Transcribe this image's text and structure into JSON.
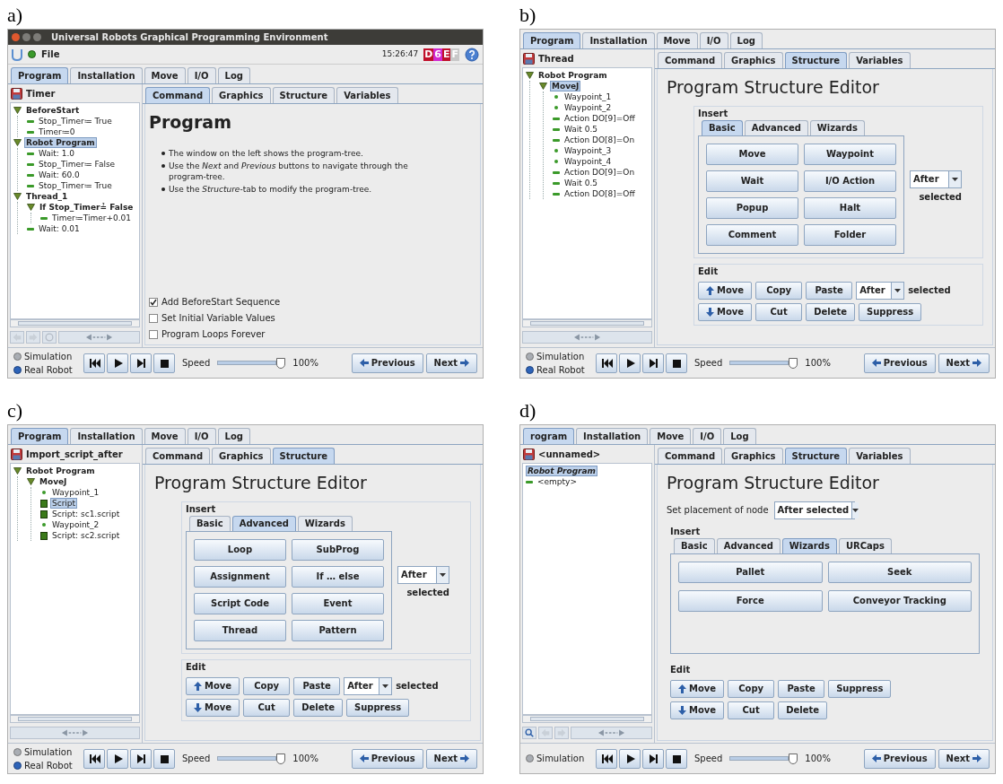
{
  "panels": [
    {
      "label": "a)",
      "window": {
        "title": "Universal Robots Graphical Programming Environment"
      },
      "menu": {
        "file": "File",
        "time": "15:26:47",
        "badge": [
          {
            "text": "D",
            "color": "#c0102a"
          },
          {
            "text": "6",
            "color": "#d02ad0"
          },
          {
            "text": "E",
            "color": "#c0102a"
          },
          {
            "text": "F",
            "color": "#c8c8c8"
          }
        ]
      },
      "tabs": [
        {
          "label": "Program",
          "selected": true
        },
        {
          "label": "Installation",
          "selected": false
        },
        {
          "label": "Move",
          "selected": false
        },
        {
          "label": "I/O",
          "selected": false
        },
        {
          "label": "Log",
          "selected": false
        }
      ],
      "program_name": "Timer",
      "subtabs": [
        {
          "label": "Command",
          "selected": true
        },
        {
          "label": "Graphics",
          "selected": false
        },
        {
          "label": "Structure",
          "selected": false
        },
        {
          "label": "Variables",
          "selected": false
        }
      ],
      "tree": [
        {
          "label": "BeforeStart",
          "kind": "group",
          "expanded": true,
          "selected": false,
          "children": [
            {
              "label": "Stop_Timer≔ True",
              "kind": "step",
              "selected": false
            },
            {
              "label": "Timer≔0",
              "kind": "step",
              "selected": false
            }
          ]
        },
        {
          "label": "Robot Program",
          "kind": "group",
          "expanded": true,
          "selected": true,
          "children": [
            {
              "label": "Wait: 1.0",
              "kind": "step",
              "selected": false
            },
            {
              "label": "Stop_Timer≔ False",
              "kind": "step",
              "selected": false
            },
            {
              "label": "Wait: 60.0",
              "kind": "step",
              "selected": false
            },
            {
              "label": "Stop_Timer≔ True",
              "kind": "step",
              "selected": false
            }
          ]
        },
        {
          "label": "Thread_1",
          "kind": "group",
          "expanded": true,
          "selected": false,
          "children": [
            {
              "label": "If Stop_Timer≟ False",
              "kind": "group",
              "expanded": true,
              "selected": false,
              "children": [
                {
                  "label": "Timer≔Timer+0.01",
                  "kind": "step",
                  "selected": false
                }
              ]
            },
            {
              "label": "Wait: 0.01",
              "kind": "step",
              "selected": false
            }
          ]
        }
      ],
      "tree_tools": [
        {
          "kind": "undo"
        },
        {
          "kind": "redo"
        },
        {
          "kind": "circle"
        },
        {
          "kind": "arrows"
        }
      ],
      "content": {
        "kind": "info",
        "heading": "Program",
        "bullets": [
          "The window on the left shows the program-tree.",
          "Use the *Next* and *Previous* buttons to navigate through the program-tree.",
          "Use the *Structure*-tab to modify the program-tree."
        ],
        "checkboxes": [
          {
            "label": "Add BeforeStart Sequence",
            "checked": true
          },
          {
            "label": "Set Initial Variable Values",
            "checked": false
          },
          {
            "label": "Program Loops Forever",
            "checked": false
          }
        ]
      },
      "footer": {
        "modes": [
          {
            "label": "Simulation",
            "selected": false
          },
          {
            "label": "Real Robot",
            "selected": true
          }
        ],
        "speed_label": "Speed",
        "speed": {
          "level": 1
        },
        "speed_reading": "100%",
        "previous": "Previous",
        "next": "Next"
      }
    },
    {
      "label": "b)",
      "tabs": [
        {
          "label": "Program",
          "selected": true
        },
        {
          "label": "Installation",
          "selected": false
        },
        {
          "label": "Move",
          "selected": false
        },
        {
          "label": "I/O",
          "selected": false
        },
        {
          "label": "Log",
          "selected": false
        }
      ],
      "program_name": "Thread",
      "subtabs": [
        {
          "label": "Command",
          "selected": false
        },
        {
          "label": "Graphics",
          "selected": false
        },
        {
          "label": "Structure",
          "selected": true
        },
        {
          "label": "Variables",
          "selected": false
        }
      ],
      "tree": [
        {
          "label": "Robot Program",
          "kind": "group",
          "expanded": true,
          "selected": false,
          "children": [
            {
              "label": "MoveJ",
              "kind": "group",
              "expanded": true,
              "selected": true,
              "children": [
                {
                  "label": "Waypoint_1",
                  "kind": "waypoint",
                  "selected": false
                },
                {
                  "label": "Waypoint_2",
                  "kind": "waypoint",
                  "selected": false
                },
                {
                  "label": "Action DO[9]=Off",
                  "kind": "step",
                  "selected": false
                },
                {
                  "label": "Wait 0.5",
                  "kind": "step",
                  "selected": false
                },
                {
                  "label": "Action DO[8]=On",
                  "kind": "step",
                  "selected": false
                },
                {
                  "label": "Waypoint_3",
                  "kind": "waypoint",
                  "selected": false
                },
                {
                  "label": "Waypoint_4",
                  "kind": "waypoint",
                  "selected": false
                },
                {
                  "label": "Action DO[9]=On",
                  "kind": "step",
                  "selected": false
                },
                {
                  "label": "Wait 0.5",
                  "kind": "step",
                  "selected": false
                },
                {
                  "label": "Action DO[8]=Off",
                  "kind": "step",
                  "selected": false
                }
              ]
            }
          ]
        }
      ],
      "tree_tools": [
        {
          "kind": "arrows"
        }
      ],
      "content": {
        "kind": "structure",
        "heading": "Program Structure Editor",
        "insert": {
          "legend": "Insert",
          "tabs": [
            {
              "label": "Basic",
              "selected": true
            },
            {
              "label": "Advanced",
              "selected": false
            },
            {
              "label": "Wizards",
              "selected": false
            }
          ],
          "buttons": [
            "Move",
            "Waypoint",
            "Wait",
            "I/O Action",
            "Popup",
            "Halt",
            "Comment",
            "Folder"
          ],
          "placement": "After",
          "placement_note": "selected"
        },
        "edit": {
          "legend": "Edit",
          "rows": [
            [
              {
                "kind": "up_button",
                "label": "Move"
              },
              {
                "kind": "button",
                "label": "Copy"
              },
              {
                "kind": "button",
                "label": "Paste"
              },
              {
                "kind": "dropdown",
                "label": "After"
              },
              {
                "kind": "text",
                "label": "selected"
              }
            ],
            [
              {
                "kind": "down_button",
                "label": "Move"
              },
              {
                "kind": "button",
                "label": "Cut"
              },
              {
                "kind": "button",
                "label": "Delete"
              },
              {
                "kind": "button",
                "label": "Suppress"
              }
            ]
          ]
        }
      },
      "footer": {
        "modes": [
          {
            "label": "Simulation",
            "selected": false
          },
          {
            "label": "Real Robot",
            "selected": true
          }
        ],
        "speed_label": "Speed",
        "speed": {
          "level": 1
        },
        "speed_reading": "100%",
        "previous": "Previous",
        "next": "Next"
      }
    },
    {
      "label": "c)",
      "tabs": [
        {
          "label": "Program",
          "selected": true
        },
        {
          "label": "Installation",
          "selected": false
        },
        {
          "label": "Move",
          "selected": false
        },
        {
          "label": "I/O",
          "selected": false
        },
        {
          "label": "Log",
          "selected": false
        }
      ],
      "program_name": "Import_script_after",
      "subtabs": [
        {
          "label": "Command",
          "selected": false
        },
        {
          "label": "Graphics",
          "selected": false
        },
        {
          "label": "Structure",
          "selected": true
        }
      ],
      "tree": [
        {
          "label": "Robot Program",
          "kind": "group",
          "expanded": true,
          "selected": false,
          "children": [
            {
              "label": "MoveJ",
              "kind": "group",
              "expanded": true,
              "selected": false,
              "children": [
                {
                  "label": "Waypoint_1",
                  "kind": "waypoint",
                  "selected": false
                },
                {
                  "label": "Script",
                  "kind": "script",
                  "selected": true
                },
                {
                  "label": "Script: sc1.script",
                  "kind": "script",
                  "selected": false
                },
                {
                  "label": "Waypoint_2",
                  "kind": "waypoint",
                  "selected": false
                },
                {
                  "label": "Script: sc2.script",
                  "kind": "script",
                  "selected": false
                }
              ]
            }
          ]
        }
      ],
      "tree_tools": [
        {
          "kind": "arrows"
        }
      ],
      "content": {
        "kind": "structure",
        "heading": "Program Structure Editor",
        "insert": {
          "legend": "Insert",
          "tabs": [
            {
              "label": "Basic",
              "selected": false
            },
            {
              "label": "Advanced",
              "selected": true
            },
            {
              "label": "Wizards",
              "selected": false
            }
          ],
          "buttons": [
            "Loop",
            "SubProg",
            "Assignment",
            "If … else",
            "Script Code",
            "Event",
            "Thread",
            "Pattern"
          ],
          "placement": "After",
          "placement_note": "selected"
        },
        "edit": {
          "legend": "Edit",
          "rows": [
            [
              {
                "kind": "up_button",
                "label": "Move"
              },
              {
                "kind": "button",
                "label": "Copy"
              },
              {
                "kind": "button",
                "label": "Paste"
              },
              {
                "kind": "dropdown",
                "label": "After"
              },
              {
                "kind": "text",
                "label": "selected"
              }
            ],
            [
              {
                "kind": "down_button",
                "label": "Move"
              },
              {
                "kind": "button",
                "label": "Cut"
              },
              {
                "kind": "button",
                "label": "Delete"
              },
              {
                "kind": "button",
                "label": "Suppress"
              }
            ]
          ]
        }
      },
      "footer": {
        "modes": [
          {
            "label": "Simulation",
            "selected": false
          },
          {
            "label": "Real Robot",
            "selected": true
          }
        ],
        "speed_label": "Speed",
        "speed": {
          "level": 1
        },
        "speed_reading": "100%",
        "previous": "Previous",
        "next": "Next"
      }
    },
    {
      "label": "d)",
      "tabs": [
        {
          "label": "rogram",
          "selected": true
        },
        {
          "label": "Installation",
          "selected": false
        },
        {
          "label": "Move",
          "selected": false
        },
        {
          "label": "I/O",
          "selected": false
        },
        {
          "label": "Log",
          "selected": false
        }
      ],
      "program_name": "<unnamed>",
      "subtabs": [
        {
          "label": "Command",
          "selected": false
        },
        {
          "label": "Graphics",
          "selected": false
        },
        {
          "label": "Structure",
          "selected": true
        },
        {
          "label": "Variables",
          "selected": false
        }
      ],
      "tree": [
        {
          "label": "Robot Program",
          "kind": "plain",
          "selected": true
        },
        {
          "label": "<empty>",
          "kind": "step",
          "selected": false
        }
      ],
      "tree_tools": [
        {
          "kind": "search"
        },
        {
          "kind": "undo"
        },
        {
          "kind": "redo"
        },
        {
          "kind": "arrows"
        }
      ],
      "content": {
        "kind": "structure",
        "heading": "Program Structure Editor",
        "placement_row": {
          "label": "Set placement of node",
          "value": "After selected"
        },
        "insert": {
          "legend": "Insert",
          "tabs": [
            {
              "label": "Basic",
              "selected": false
            },
            {
              "label": "Advanced",
              "selected": false
            },
            {
              "label": "Wizards",
              "selected": true
            },
            {
              "label": "URCaps",
              "selected": false
            }
          ],
          "buttons": [
            "Pallet",
            "Seek",
            "Force",
            "Conveyor Tracking"
          ]
        },
        "edit": {
          "legend": "Edit",
          "rows": [
            [
              {
                "kind": "up_button",
                "label": "Move"
              },
              {
                "kind": "button",
                "label": "Copy"
              },
              {
                "kind": "button",
                "label": "Paste"
              },
              {
                "kind": "button",
                "label": "Suppress"
              }
            ],
            [
              {
                "kind": "down_button",
                "label": "Move"
              },
              {
                "kind": "button",
                "label": "Cut"
              },
              {
                "kind": "button",
                "label": "Delete"
              }
            ]
          ]
        }
      },
      "footer": {
        "modes": [
          {
            "label": "Simulation",
            "selected": false
          }
        ],
        "speed_label": "Speed",
        "speed": {
          "level": 1
        },
        "speed_reading": "100%",
        "previous": "Previous",
        "next": "Next"
      }
    }
  ]
}
